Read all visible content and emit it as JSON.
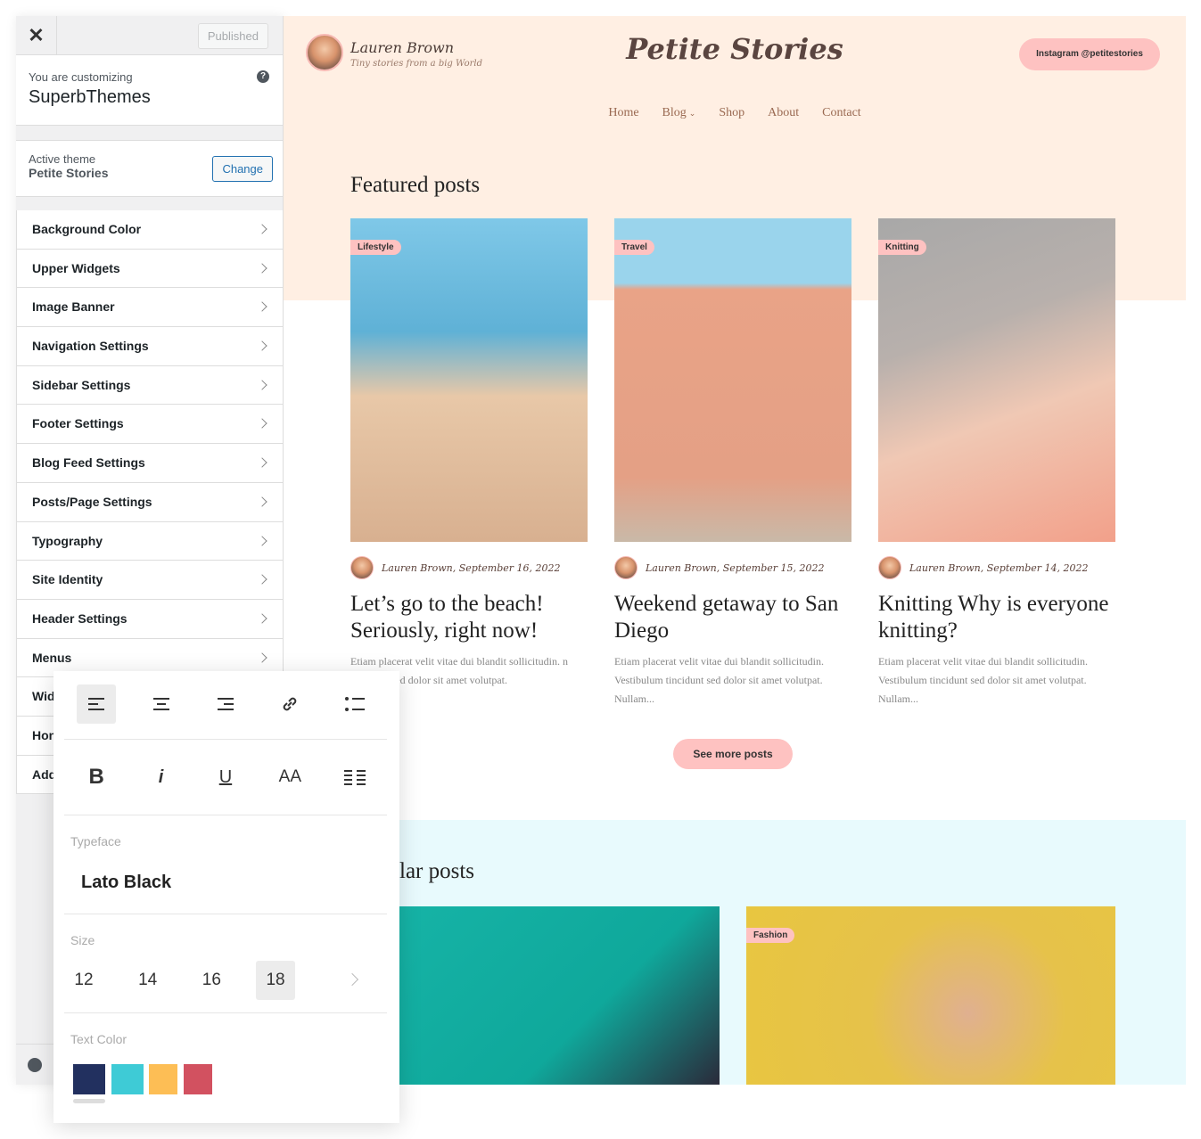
{
  "sidebar": {
    "close_icon": "close-icon",
    "published_label": "Published",
    "customizing_label": "You are customizing",
    "site_name": "SuperbThemes",
    "active_theme_label": "Active theme",
    "active_theme": "Petite Stories",
    "change_label": "Change",
    "items": [
      {
        "label": "Background Color"
      },
      {
        "label": "Upper Widgets"
      },
      {
        "label": "Image Banner"
      },
      {
        "label": "Navigation Settings"
      },
      {
        "label": "Sidebar Settings"
      },
      {
        "label": "Footer Settings"
      },
      {
        "label": "Blog Feed Settings"
      },
      {
        "label": "Posts/Page Settings"
      },
      {
        "label": "Typography"
      },
      {
        "label": "Site Identity"
      },
      {
        "label": "Header Settings"
      },
      {
        "label": "Menus"
      },
      {
        "label": "Wid"
      },
      {
        "label": "Hon"
      },
      {
        "label": "Add"
      }
    ]
  },
  "site": {
    "author": "Lauren Brown",
    "tagline": "Tiny stories from a big World",
    "title": "Petite Stories",
    "instagram_label": "Instagram @petitestories",
    "nav": [
      "Home",
      "Blog",
      "Shop",
      "About",
      "Contact"
    ],
    "featured_heading": "Featured posts",
    "popular_heading": "lar posts",
    "see_more_label": "See more posts",
    "posts": [
      {
        "tag": "Lifestyle",
        "meta": "Lauren Brown, September 16, 2022",
        "title": "Let’s go to the beach! Seriously, right now!",
        "excerpt": "Etiam placerat velit vitae dui blandit sollicitudin. n tincidunt sed dolor sit amet volutpat."
      },
      {
        "tag": "Travel",
        "meta": "Lauren Brown, September 15, 2022",
        "title": "Weekend getaway to San Diego",
        "excerpt": "Etiam placerat velit vitae dui blandit sollicitudin. Vestibulum tincidunt sed dolor sit amet volutpat. Nullam..."
      },
      {
        "tag": "Knitting",
        "meta": "Lauren Brown, September 14, 2022",
        "title": "Knitting Why is everyone knitting?",
        "excerpt": "Etiam placerat velit vitae dui blandit sollicitudin. Vestibulum tincidunt sed dolor sit amet volutpat. Nullam..."
      }
    ],
    "popular_tag": "Fashion"
  },
  "toolbar": {
    "bold": "B",
    "italic": "i",
    "underline": "U",
    "caps": "AA",
    "typeface_label": "Typeface",
    "typeface": "Lato Black",
    "size_label": "Size",
    "sizes": [
      "12",
      "14",
      "16",
      "18"
    ],
    "selected_size": "18",
    "text_color_label": "Text Color",
    "colors": [
      "#22305f",
      "#3ecbd6",
      "#fdbe55",
      "#d25160"
    ],
    "selected_color": "#22305f"
  },
  "colors": {
    "accent_pink": "#fec2c1",
    "peach": "#ffefe3",
    "wp_blue": "#2271b1"
  }
}
